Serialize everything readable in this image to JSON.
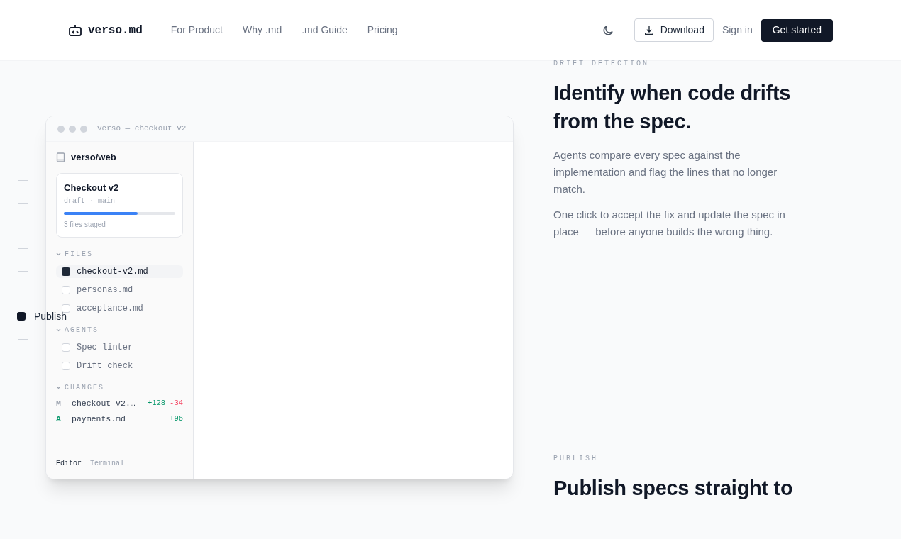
{
  "header": {
    "logo": "verso.md",
    "nav": [
      {
        "label": "For Product"
      },
      {
        "label": "Why .md"
      },
      {
        "label": ".md Guide"
      },
      {
        "label": "Pricing"
      }
    ],
    "download": "Download",
    "sign_in": "Sign in",
    "cta": "Get started"
  },
  "side_nav": [
    {
      "selected": false
    },
    {
      "selected": false
    },
    {
      "selected": false
    },
    {
      "selected": false
    },
    {
      "selected": false
    },
    {
      "selected": false
    },
    {
      "selected": true,
      "label": "Publish"
    },
    {
      "selected": false
    },
    {
      "selected": false
    }
  ],
  "app_window": {
    "title": "verso — checkout v2",
    "repo": "verso/web",
    "card": {
      "title": "Checkout v2",
      "meta": "draft · main",
      "level": 0.66,
      "note": "3 files staged"
    },
    "sections": [
      {
        "title": "FILES",
        "kind": "checklist",
        "items": [
          {
            "label": "checkout-v2.md",
            "checked": true,
            "selected": true
          },
          {
            "label": "personas.md",
            "checked": false,
            "selected": false
          },
          {
            "label": "acceptance.md",
            "checked": false,
            "selected": false
          }
        ]
      },
      {
        "title": "AGENTS",
        "kind": "checklist",
        "items": [
          {
            "label": "Spec linter",
            "checked": false,
            "selected": false
          },
          {
            "label": "Drift check",
            "checked": false,
            "selected": false
          }
        ]
      },
      {
        "title": "CHANGES",
        "kind": "changes",
        "items": [
          {
            "status": "M",
            "color": "#9ca3af",
            "name": "checkout-v2.…",
            "added": "+128",
            "removed": "-34"
          },
          {
            "status": "A",
            "color": "#059669",
            "name": "payments.md",
            "added": "+96"
          }
        ]
      }
    ],
    "tabs": [
      {
        "label": "Editor",
        "selected": true
      },
      {
        "label": "Terminal",
        "selected": false
      }
    ]
  },
  "sections": [
    {
      "eyebrow": "DRIFT DETECTION",
      "heading": "Identify when code drifts from the spec.",
      "paragraphs": [
        "Agents compare every spec against the implementation and flag the lines that no longer match.",
        "One click to accept the fix and update the spec in place — before anyone builds the wrong thing."
      ]
    },
    {
      "eyebrow": "PUBLISH",
      "heading": "Publish specs straight to"
    }
  ]
}
